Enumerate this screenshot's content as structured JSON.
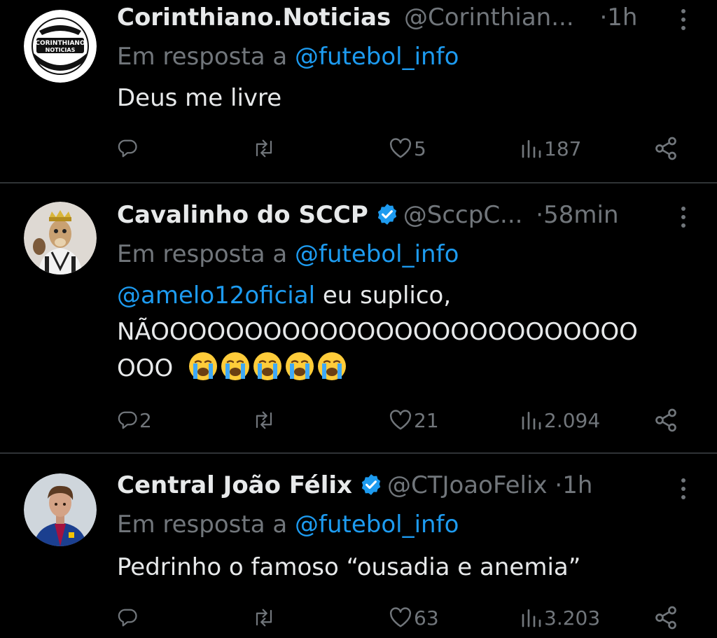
{
  "colors": {
    "background": "#000000",
    "text": "#e7e9ea",
    "secondary": "#71767b",
    "accent": "#1d9bf0",
    "divider": "#2f3336"
  },
  "tweets": [
    {
      "name": "Corinthiano.Noticias",
      "handle": "@Corinthian...",
      "separator": "·",
      "time": "1h",
      "verified": false,
      "avatar_label_1": "CORINTHIANO",
      "avatar_label_2": "NOTICIAS",
      "reply_prefix": "Em resposta a",
      "reply_to": "@futebol_info",
      "text": "Deus me livre",
      "replies": "",
      "reposts": "",
      "likes": "5",
      "views": "187"
    },
    {
      "name": "Cavalinho do SCCP",
      "handle": "@SccpC...",
      "separator": "·",
      "time": "58min",
      "verified": true,
      "reply_prefix": "Em resposta a",
      "reply_to": "@futebol_info",
      "mention": "@amelo12oficial",
      "text_after_mention": " eu suplico,",
      "text_line2": "NÃOOOOOOOOOOOOOOOOOOOOOOOOOO",
      "text_line3": "OOO",
      "emoji": "loudly-crying-face x5",
      "replies": "2",
      "reposts": "",
      "likes": "21",
      "views": "2.094"
    },
    {
      "name": "Central João Félix",
      "handle": "@CTJoaoFelix",
      "separator": "·",
      "time": "1h",
      "verified": true,
      "reply_prefix": "Em resposta a",
      "reply_to": "@futebol_info",
      "text": "Pedrinho o famoso “ousadia e anemia”",
      "replies": "",
      "reposts": "",
      "likes": "63",
      "views": "3.203"
    }
  ]
}
